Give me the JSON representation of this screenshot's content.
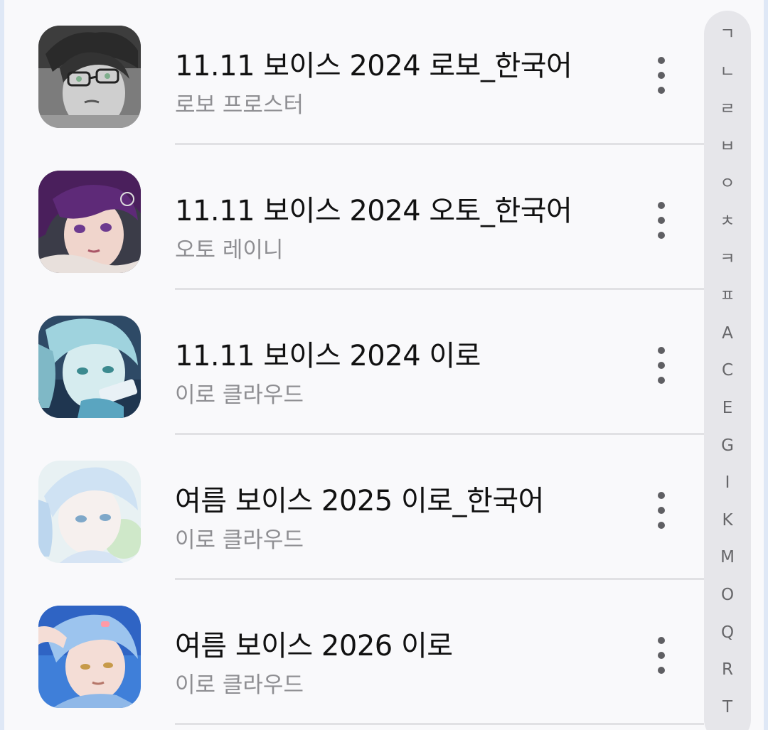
{
  "items": [
    {
      "title": "11.11 보이스 2024 로보_한국어",
      "subtitle": "로보 프로스터",
      "thumbnail_icon": "character-robo-glasses"
    },
    {
      "title": "11.11 보이스 2024 오토_한국어",
      "subtitle": "오토 레이니",
      "thumbnail_icon": "character-oto-purple-hair"
    },
    {
      "title": "11.11 보이스 2024 이로",
      "subtitle": "이로 클라우드",
      "thumbnail_icon": "character-iro-blue"
    },
    {
      "title": "여름 보이스 2025 이로_한국어",
      "subtitle": "이로 클라우드",
      "thumbnail_icon": "character-iro-summer-light"
    },
    {
      "title": "여름 보이스 2026 이로",
      "subtitle": "이로 클라우드",
      "thumbnail_icon": "character-iro-summer-sky"
    }
  ],
  "index_letters": [
    "ㄱ",
    "ㄴ",
    "ㄹ",
    "ㅂ",
    "ㅇ",
    "ㅊ",
    "ㅋ",
    "ㅍ",
    "A",
    "C",
    "E",
    "G",
    "I",
    "K",
    "M",
    "O",
    "Q",
    "R",
    "T"
  ],
  "colors": {
    "background": "#f9f9fb",
    "title": "#111111",
    "subtitle": "#8e8e92",
    "divider": "#e1e1e4",
    "index_bar": "#e6e6ea"
  }
}
